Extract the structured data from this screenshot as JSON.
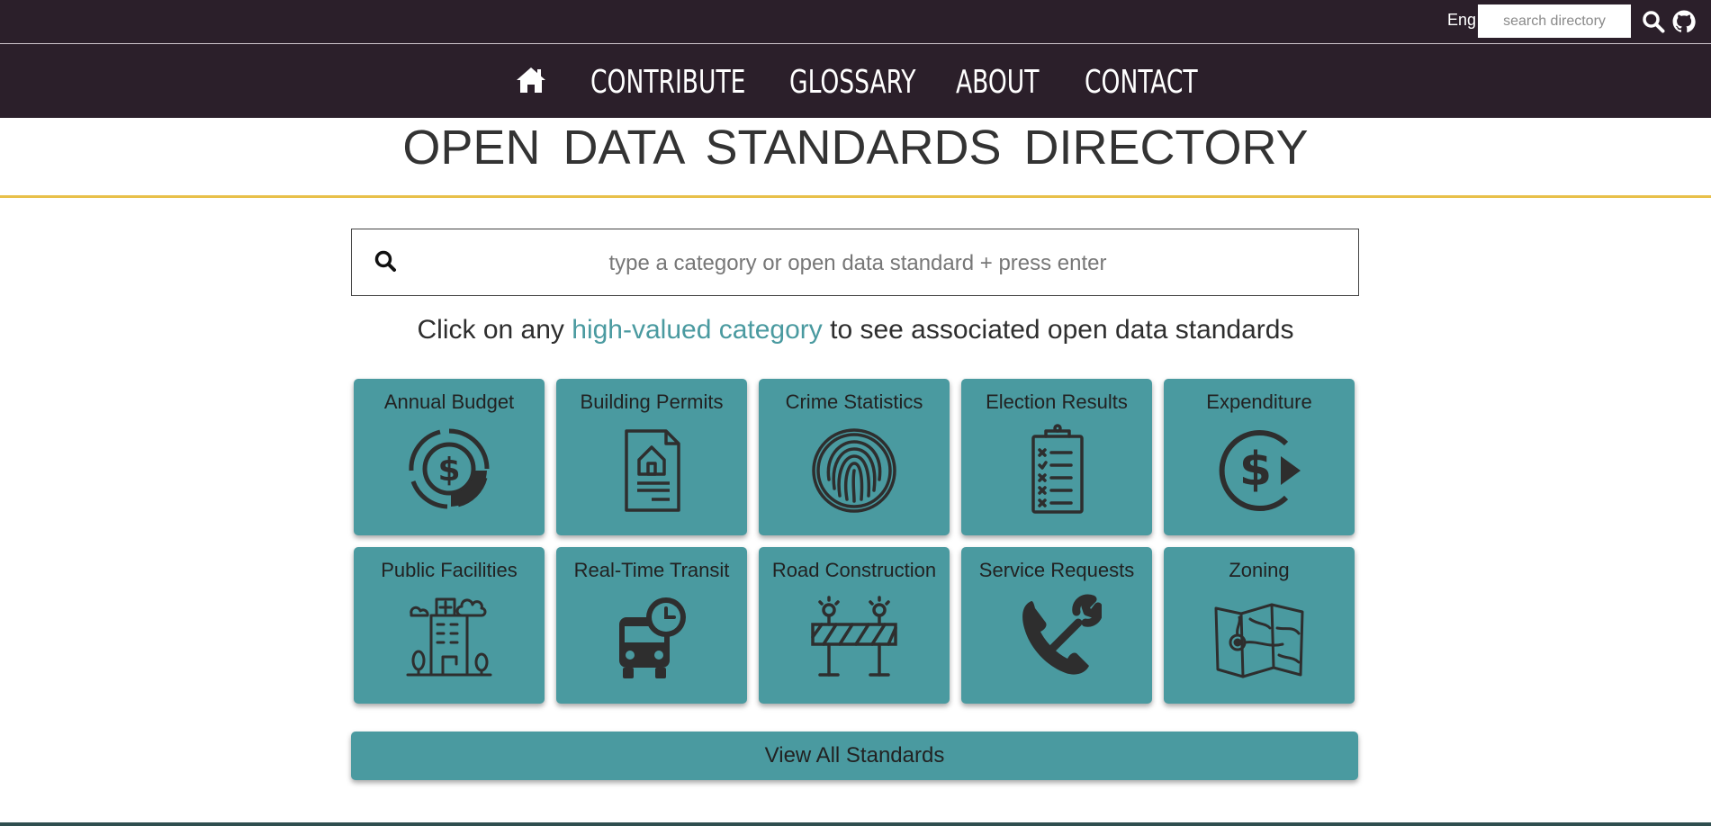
{
  "topbar": {
    "lang_label": "Eng",
    "search_placeholder": "search directory",
    "icons": [
      "search-icon",
      "github-icon"
    ]
  },
  "nav": {
    "home_icon": "home-icon",
    "links": [
      "CONTRIBUTE",
      "GLOSSARY",
      "ABOUT",
      "CONTACT"
    ]
  },
  "page": {
    "title": "OPEN  DATA  STANDARDS  DIRECTORY",
    "search_placeholder": "type a category or open data standard + press enter",
    "prompt_before": "Click on any ",
    "prompt_highlight": "high-valued category",
    "prompt_after": " to see associated open data standards"
  },
  "categories": [
    {
      "label": "Annual Budget",
      "icon": "budget-dollar-icon"
    },
    {
      "label": "Building Permits",
      "icon": "building-permit-document-icon"
    },
    {
      "label": "Crime Statistics",
      "icon": "fingerprint-icon"
    },
    {
      "label": "Election Results",
      "icon": "clipboard-checklist-icon"
    },
    {
      "label": "Expenditure",
      "icon": "dollar-arrow-icon"
    },
    {
      "label": "Public Facilities",
      "icon": "hospital-building-icon"
    },
    {
      "label": "Real-Time Transit",
      "icon": "bus-clock-icon"
    },
    {
      "label": "Road Construction",
      "icon": "road-barrier-icon"
    },
    {
      "label": "Service Requests",
      "icon": "phone-wrench-icon"
    },
    {
      "label": "Zoning",
      "icon": "map-icon"
    }
  ],
  "view_all_label": "View All Standards",
  "colors": {
    "header_bg": "#2b1f2a",
    "accent_teal": "#4a9aa0",
    "title_underline": "#e8c04a"
  }
}
